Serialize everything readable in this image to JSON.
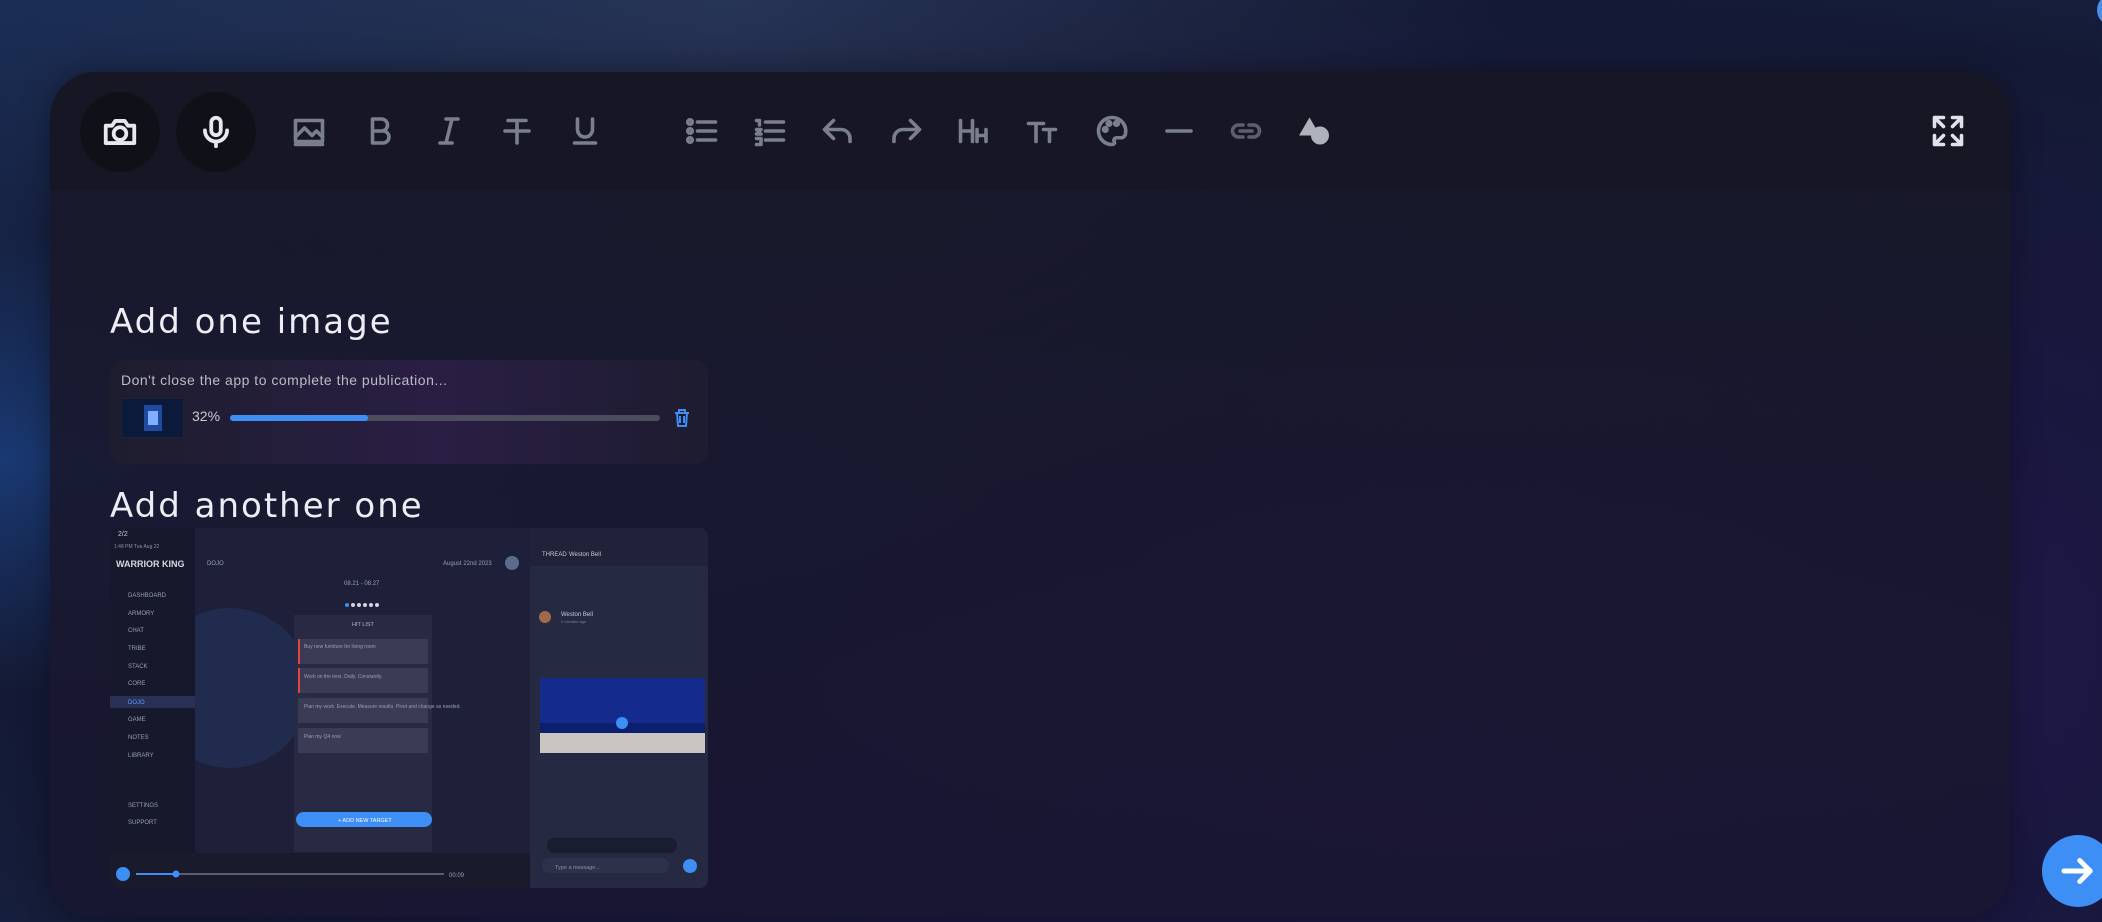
{
  "toolbar": {
    "items": [
      {
        "name": "camera-icon"
      },
      {
        "name": "microphone-icon"
      },
      {
        "name": "image-icon"
      },
      {
        "name": "bold-icon",
        "label": "B"
      },
      {
        "name": "italic-icon",
        "label": "I"
      },
      {
        "name": "strikethrough-icon"
      },
      {
        "name": "underline-icon"
      },
      {
        "name": "bulleted-list-icon"
      },
      {
        "name": "numbered-list-icon"
      },
      {
        "name": "undo-icon"
      },
      {
        "name": "redo-icon"
      },
      {
        "name": "heading-icon",
        "label": "HH"
      },
      {
        "name": "text-size-icon",
        "label": "TT"
      },
      {
        "name": "palette-icon"
      },
      {
        "name": "horizontal-rule-icon"
      },
      {
        "name": "link-icon"
      },
      {
        "name": "shapes-icon"
      },
      {
        "name": "fullscreen-icon"
      }
    ]
  },
  "sections": {
    "first_heading": "Add one image",
    "second_heading": "Add another one"
  },
  "upload": {
    "message": "Don't close the app to complete the publication...",
    "percent_label": "32%",
    "progress": 0.32
  },
  "screenshot": {
    "counter": "2/2",
    "status_time": "1:48 PM   Tue Aug 22",
    "brand": "WARRIOR KING",
    "nav_items": [
      "DASHBOARD",
      "ARMORY",
      "CHAT",
      "TRIBE",
      "STACK",
      "CORE",
      "DOJO",
      "GAME",
      "NOTES",
      "LIBRARY"
    ],
    "nav_bottom": [
      "SETTINGS",
      "SUPPORT"
    ],
    "page_title": "DOJO",
    "date_label": "August 22nd 2023",
    "range_label": "08.21 - 08.27",
    "list_title": "HIT LIST",
    "list_items": [
      "Buy new furniture for living room",
      "Work on the lens. Daily. Constantly.",
      "Plan my work. Execute. Measure results. Pivot and change as needed.",
      "Plan my Q4 now"
    ],
    "add_button": "+ ADD NEW TARGET",
    "video_time": "00:09",
    "thread_tab": "THREAD",
    "thread_user": "Weston Bell",
    "thread_sub": "2 minutes ago",
    "message_placeholder": "Type a message..."
  },
  "colors": {
    "accent": "#3d8ef5",
    "track": "#4b4d5c"
  }
}
